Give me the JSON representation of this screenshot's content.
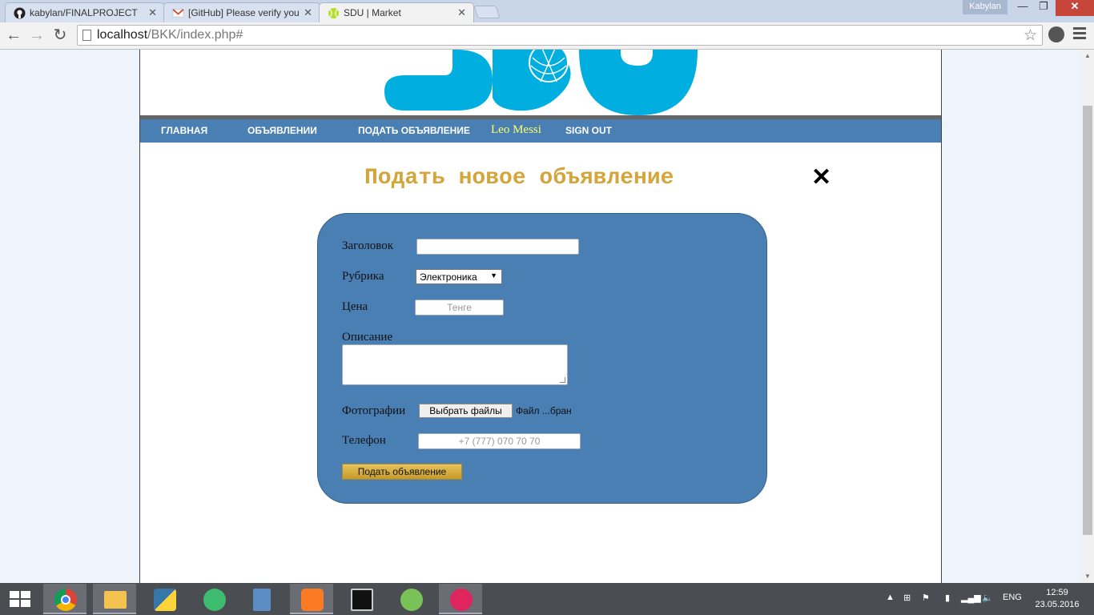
{
  "browser": {
    "tabs": [
      {
        "title": "kabylan/FINALPROJECT",
        "active": false,
        "icon": "github-icon"
      },
      {
        "title": "[GitHub] Please verify you",
        "active": false,
        "icon": "gmail-icon"
      },
      {
        "title": "SDU | Market",
        "active": true,
        "icon": "tennis-ball-icon"
      }
    ],
    "user_badge": "Kabylan",
    "url_host": "localhost",
    "url_path": "/BKK/index.php#"
  },
  "site": {
    "nav": {
      "home": "ГЛАВНАЯ",
      "ads": "ОБЪЯВЛЕНИИ",
      "post_ad": "ПОДАТЬ ОБЪЯВЛЕНИЕ",
      "user": "Leo Messi",
      "sign_out": "SIGN OUT"
    },
    "form": {
      "title": "Подать новое объявление",
      "close_symbol": "✕",
      "headline_label": "Заголовок",
      "headline_value": "",
      "category_label": "Рубрика",
      "category_selected": "Электроника",
      "price_label": "Цена",
      "price_placeholder": "Тенге",
      "description_label": "Описание",
      "photos_label": "Фотографии",
      "choose_files_button": "Выбрать файлы",
      "file_status": "Файл ...бран",
      "phone_label": "Телефон",
      "phone_placeholder": "+7 (777) 070 70 70",
      "submit_button": "Подать объявление"
    }
  },
  "taskbar": {
    "language": "ENG",
    "time": "12:59",
    "date": "23.05.2016"
  },
  "colors": {
    "nav_bar": "#4a7fb4",
    "form_panel": "#4a7fb4",
    "title_gold": "#d4a53b",
    "logo_cyan": "#00aee0"
  }
}
